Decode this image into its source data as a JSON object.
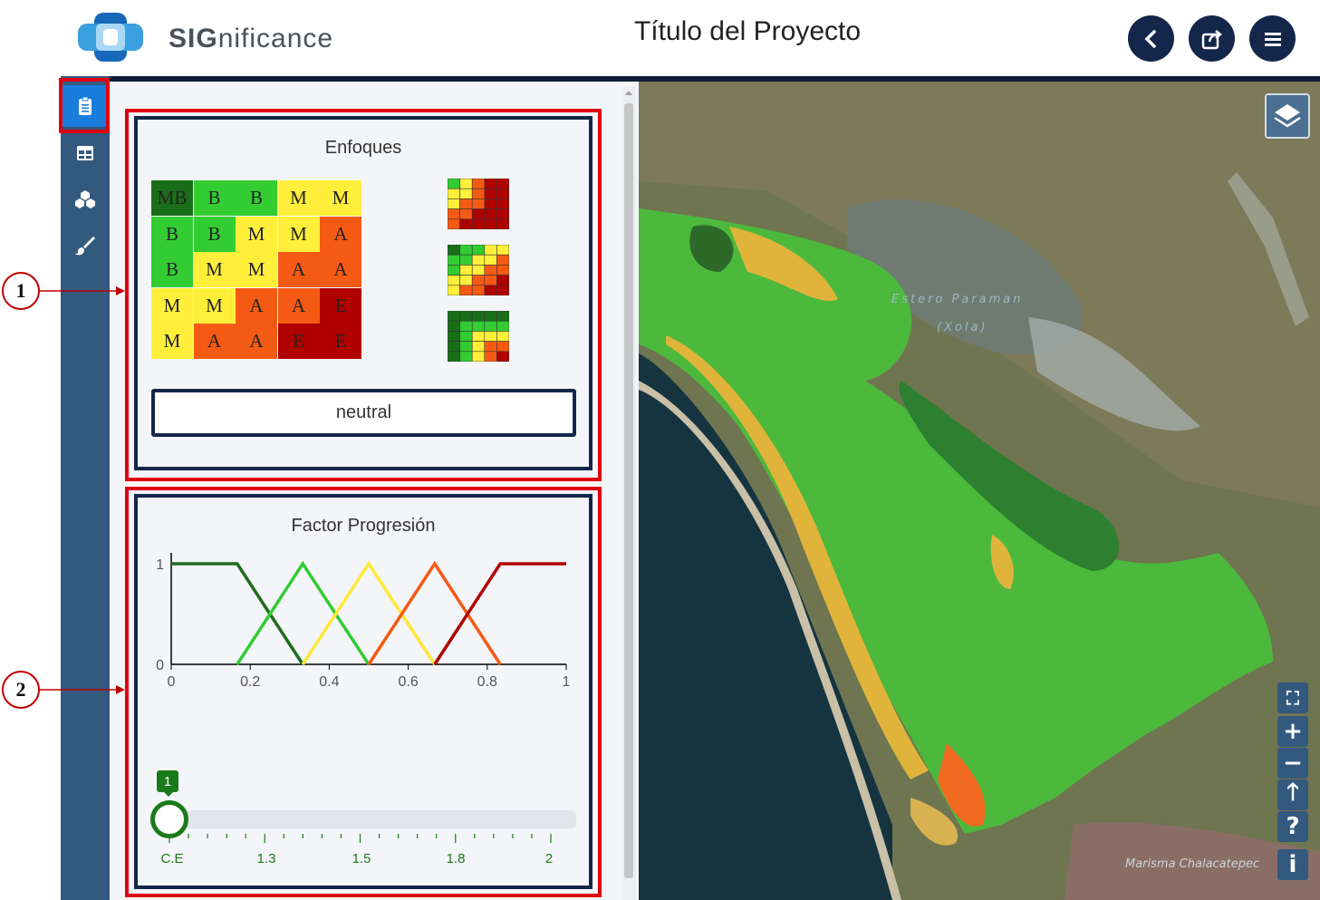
{
  "header": {
    "brand_bold": "SIG",
    "brand_rest": "nificance",
    "title": "Título del Proyecto",
    "buttons": [
      {
        "name": "back-icon"
      },
      {
        "name": "share-icon"
      },
      {
        "name": "menu-icon"
      }
    ],
    "color_primary": "#14264a"
  },
  "sidebar": {
    "items": [
      {
        "icon": "clipboard-icon",
        "active": true
      },
      {
        "icon": "table-icon",
        "active": false
      },
      {
        "icon": "cubes-icon",
        "active": false
      },
      {
        "icon": "brush-icon",
        "active": false
      }
    ]
  },
  "enfoques": {
    "title": "Enfoques",
    "matrix": [
      [
        "MB",
        "B",
        "B",
        "M",
        "M"
      ],
      [
        "B",
        "B",
        "M",
        "M",
        "A"
      ],
      [
        "B",
        "M",
        "M",
        "A",
        "A"
      ],
      [
        "M",
        "M",
        "A",
        "A",
        "E"
      ],
      [
        "M",
        "A",
        "A",
        "E",
        "E"
      ]
    ],
    "colors": {
      "MB": "#1a6e1a",
      "B": "#33cc33",
      "M": "#ffef3a",
      "A": "#f55a14",
      "E": "#b00000"
    },
    "mini_matrices": [
      [
        [
          "B",
          "M",
          "A",
          "E",
          "E"
        ],
        [
          "M",
          "M",
          "A",
          "E",
          "E"
        ],
        [
          "M",
          "A",
          "A",
          "E",
          "E"
        ],
        [
          "A",
          "A",
          "E",
          "E",
          "E"
        ],
        [
          "A",
          "E",
          "E",
          "E",
          "E"
        ]
      ],
      [
        [
          "MB",
          "B",
          "B",
          "M",
          "M"
        ],
        [
          "B",
          "B",
          "M",
          "M",
          "A"
        ],
        [
          "B",
          "M",
          "M",
          "A",
          "A"
        ],
        [
          "M",
          "M",
          "A",
          "A",
          "E"
        ],
        [
          "M",
          "A",
          "A",
          "E",
          "E"
        ]
      ],
      [
        [
          "MB",
          "MB",
          "MB",
          "MB",
          "MB"
        ],
        [
          "MB",
          "B",
          "B",
          "B",
          "B"
        ],
        [
          "MB",
          "B",
          "M",
          "M",
          "M"
        ],
        [
          "MB",
          "B",
          "M",
          "A",
          "A"
        ],
        [
          "MB",
          "B",
          "M",
          "A",
          "E"
        ]
      ]
    ],
    "button_label": "neutral"
  },
  "factor": {
    "title": "Factor Progresión",
    "chart_data": {
      "type": "line",
      "xlim": [
        0,
        1
      ],
      "ylim": [
        0,
        1
      ],
      "x_ticks": [
        "0",
        "0.2",
        "0.4",
        "0.6",
        "0.8",
        "1"
      ],
      "y_ticks": [
        "0",
        "1"
      ],
      "series": [
        {
          "color": "#1f6b1f",
          "x": [
            0,
            0.167,
            0.333
          ],
          "y": [
            1,
            1,
            0
          ]
        },
        {
          "color": "#33cc33",
          "x": [
            0.167,
            0.333,
            0.5
          ],
          "y": [
            0,
            1,
            0
          ]
        },
        {
          "color": "#ffe83a",
          "x": [
            0.333,
            0.5,
            0.667
          ],
          "y": [
            0,
            1,
            0
          ]
        },
        {
          "color": "#f55a14",
          "x": [
            0.5,
            0.667,
            0.833
          ],
          "y": [
            0,
            1,
            0
          ]
        },
        {
          "color": "#b00000",
          "x": [
            0.667,
            0.833,
            1
          ],
          "y": [
            0,
            1,
            1
          ]
        }
      ]
    },
    "slider": {
      "value_label": "1",
      "value_fraction": 0,
      "tick_labels": [
        "C.E",
        "1.3",
        "1.5",
        "1.8",
        "2"
      ],
      "color": "#1a7a1a"
    }
  },
  "map": {
    "labels": {
      "estero_line1": "Estero Paraman",
      "estero_line2": "(Xola)",
      "marisma": "Marisma Chalacatepec"
    },
    "controls": [
      {
        "icon": "fullscreen-icon",
        "glyph": "⛶"
      },
      {
        "icon": "zoom-in-icon",
        "glyph": "+"
      },
      {
        "icon": "zoom-out-icon",
        "glyph": "−"
      },
      {
        "icon": "north-arrow-icon",
        "glyph": "🡑"
      },
      {
        "icon": "help-icon",
        "glyph": "?"
      },
      {
        "icon": "info-icon",
        "glyph": "i"
      }
    ]
  },
  "callouts": [
    "1",
    "2"
  ]
}
